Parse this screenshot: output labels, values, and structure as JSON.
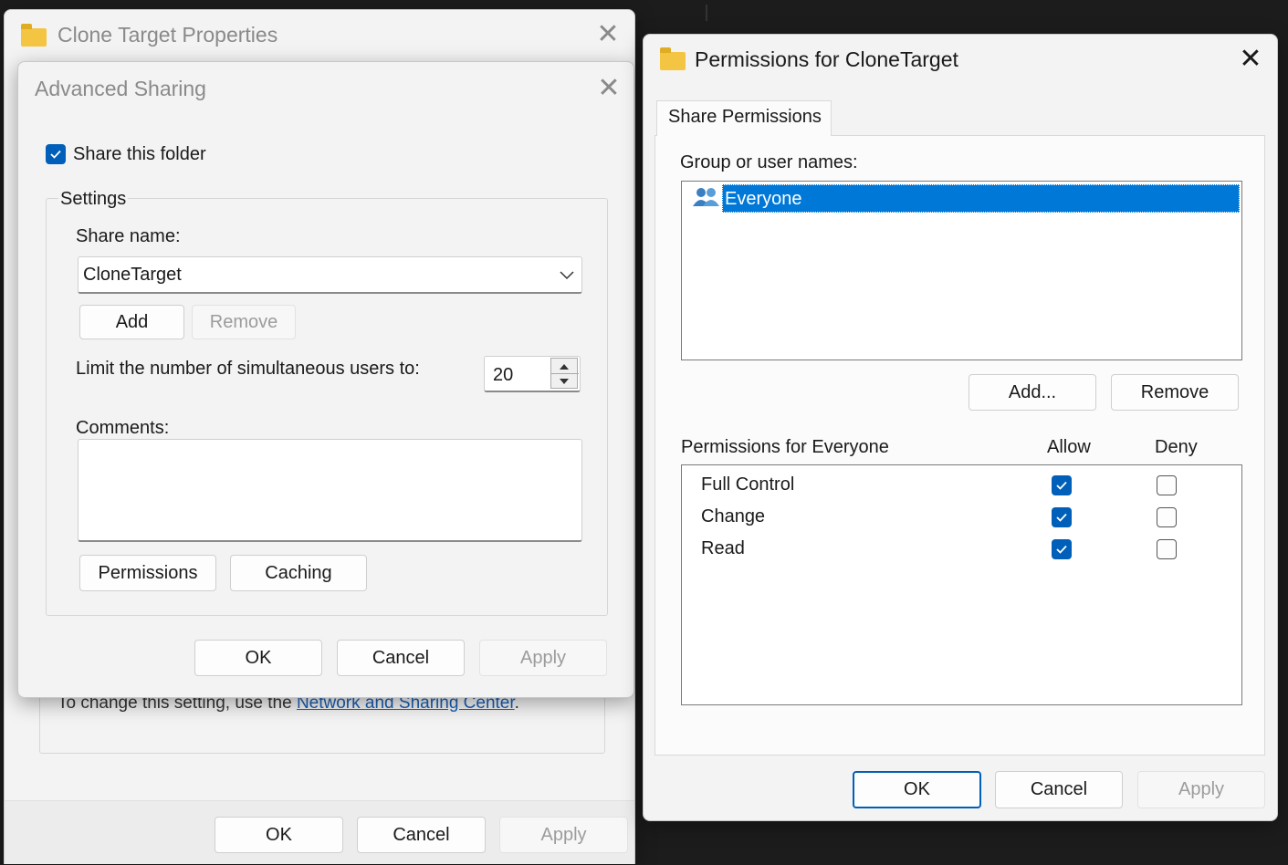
{
  "back_window": {
    "title": "Clone Target Properties",
    "note_text": "To change this setting, use the",
    "note_link": "Network and Sharing Center",
    "note_end": ".",
    "buttons": {
      "ok": "OK",
      "cancel": "Cancel",
      "apply": "Apply"
    }
  },
  "advanced_sharing": {
    "title": "Advanced Sharing",
    "share_checkbox_label": "Share this folder",
    "settings_group_label": "Settings",
    "share_name_label": "Share name:",
    "share_name_value": "CloneTarget",
    "add_label": "Add",
    "remove_label": "Remove",
    "limit_label": "Limit the number of simultaneous users to:",
    "limit_value": "20",
    "comments_label": "Comments:",
    "permissions_label": "Permissions",
    "caching_label": "Caching",
    "buttons": {
      "ok": "OK",
      "cancel": "Cancel",
      "apply": "Apply"
    }
  },
  "permissions_window": {
    "title": "Permissions for CloneTarget",
    "tab_label": "Share Permissions",
    "group_label": "Group or user names:",
    "users": [
      {
        "name": "Everyone",
        "icon": "users-icon",
        "selected": true
      }
    ],
    "add_label": "Add...",
    "remove_label": "Remove",
    "perm_header": "Permissions for Everyone",
    "allow_header": "Allow",
    "deny_header": "Deny",
    "permissions": [
      {
        "name": "Full Control",
        "allow": true,
        "deny": false
      },
      {
        "name": "Change",
        "allow": true,
        "deny": false
      },
      {
        "name": "Read",
        "allow": true,
        "deny": false
      }
    ],
    "buttons": {
      "ok": "OK",
      "cancel": "Cancel",
      "apply": "Apply"
    }
  },
  "colors": {
    "accent": "#005fb8",
    "selection": "#0078d7"
  }
}
